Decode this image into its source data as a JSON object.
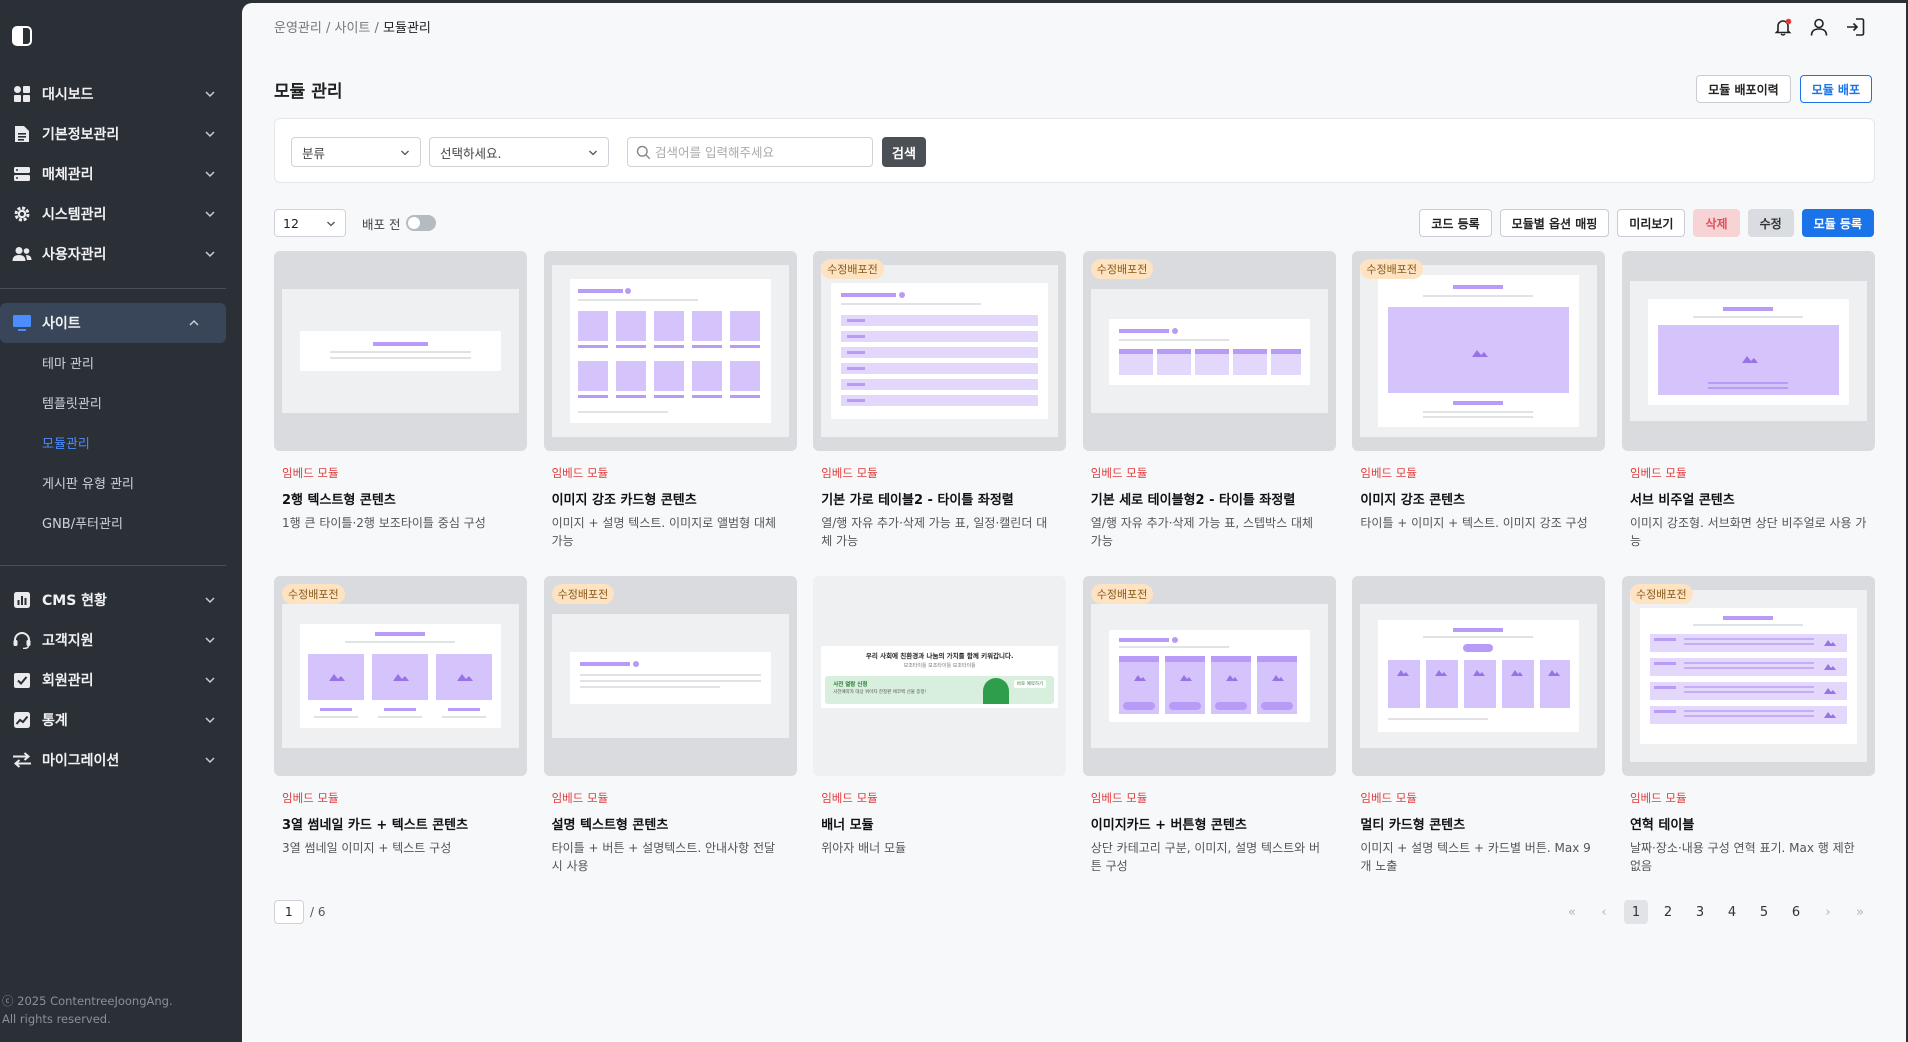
{
  "sidebar": {
    "menu": [
      {
        "label": "대시보드",
        "icon": "dashboard-icon"
      },
      {
        "label": "기본정보관리",
        "icon": "document-icon"
      },
      {
        "label": "매체관리",
        "icon": "server-icon"
      },
      {
        "label": "시스템관리",
        "icon": "gear-icon"
      },
      {
        "label": "사용자관리",
        "icon": "users-icon"
      }
    ],
    "site": {
      "label": "사이트",
      "icon": "monitor-icon",
      "sub": [
        "테마 관리",
        "템플릿관리",
        "모듈관리",
        "게시판 유형 관리",
        "GNB/푸터관리"
      ]
    },
    "menu2": [
      {
        "label": "CMS 현황",
        "icon": "chart-icon"
      },
      {
        "label": "고객지원",
        "icon": "headset-icon"
      },
      {
        "label": "회원관리",
        "icon": "checklist-icon"
      },
      {
        "label": "통계",
        "icon": "trend-icon"
      },
      {
        "label": "마이그레이션",
        "icon": "migrate-icon"
      }
    ],
    "copyright_1": "ⓒ 2025 ContentreeJoongAng.",
    "copyright_2": "All rights reserved."
  },
  "breadcrumb": {
    "a": "운영관리",
    "b": "사이트",
    "c": "모듈관리",
    "sep": " / "
  },
  "page": {
    "title": "모듈 관리",
    "btn_history": "모듈 배포이력",
    "btn_deploy": "모듈 배포"
  },
  "search": {
    "category": "분류",
    "select": "선택하세요.",
    "placeholder": "검색어를 입력해주세요",
    "button": "검색"
  },
  "toolbar": {
    "page_size": "12",
    "toggle_label": "배포 전",
    "code_register": "코드 등록",
    "option_mapping": "모듈별 옵션 매핑",
    "preview": "미리보기",
    "delete": "삭제",
    "edit": "수정",
    "module_register": "모듈 등록"
  },
  "cards": [
    {
      "badge": "",
      "cat": "임베드 모듈",
      "title": "2행 텍스트형 콘텐츠",
      "desc": "1행 큰 타이틀·2행 보조타이틀 중심 구성"
    },
    {
      "badge": "",
      "cat": "임베드 모듈",
      "title": "이미지 강조 카드형 콘텐츠",
      "desc": "이미지 + 설명 텍스트. 이미지로 앨범형 대체 가능"
    },
    {
      "badge": "수정배포전",
      "cat": "임베드 모듈",
      "title": "기본 가로 테이블2 - 타이틀 좌정렬",
      "desc": "열/행 자유 추가·삭제 가능 표, 일정·캘린더 대체 가능"
    },
    {
      "badge": "수정배포전",
      "cat": "임베드 모듈",
      "title": "기본 세로 테이블형2 - 타이틀 좌정렬",
      "desc": "열/행 자유 추가·삭제 가능 표, 스텝박스 대체 가능"
    },
    {
      "badge": "수정배포전",
      "cat": "임베드 모듈",
      "title": "이미지 강조 콘텐츠",
      "desc": "타이틀 + 이미지 + 텍스트. 이미지 강조 구성"
    },
    {
      "badge": "",
      "cat": "임베드 모듈",
      "title": "서브 비주얼 콘텐츠",
      "desc": "이미지 강조형. 서브화면 상단 비주얼로 사용 가능"
    },
    {
      "badge": "수정배포전",
      "cat": "임베드 모듈",
      "title": "3열 썸네일 카드 + 텍스트 콘텐츠",
      "desc": "3열 썸네일 이미지 + 텍스트 구성"
    },
    {
      "badge": "수정배포전",
      "cat": "임베드 모듈",
      "title": "설명 텍스트형 콘텐츠",
      "desc": "타이틀 + 버튼 + 설명텍스트. 안내사항 전달 시 사용"
    },
    {
      "badge": "",
      "cat": "임베드 모듈",
      "title": "배너 모듈",
      "desc": "위아자 배너 모듈"
    },
    {
      "badge": "수정배포전",
      "cat": "임베드 모듈",
      "title": "이미지카드 + 버튼형 콘텐츠",
      "desc": "상단 카테고리 구분, 이미지, 설명 텍스트와 버튼 구성"
    },
    {
      "badge": "",
      "cat": "임베드 모듈",
      "title": "멀티 카드형 콘텐츠",
      "desc": "이미지 + 설명 텍스트 + 카드별 버튼. Max 9개 노출"
    },
    {
      "badge": "수정배포전",
      "cat": "임베드 모듈",
      "title": "연혁 테이블",
      "desc": "날짜·장소·내용 구성 연혁 표기. Max 행 제한 없음"
    }
  ],
  "banner": {
    "headline": "우리 사회에 친환경과 나눔의 가치를 함께 키워갑니다.",
    "sub": "보조타이틀 보조타이틀 보조타이틀",
    "strip_title": "사전 열람 신청",
    "strip_text": "사전예약자 대상 위아자 한정판 에코백 선물 증정!",
    "strip_btn": "바로 예약하기"
  },
  "pager": {
    "current": "1",
    "total": "/ 6",
    "pages": [
      "1",
      "2",
      "3",
      "4",
      "5",
      "6"
    ]
  },
  "colors": {
    "accent": "#1a73e8",
    "thumb_purple": "#d5c4fb",
    "badge_bg": "#fde3c2",
    "category": "#e03c3c"
  }
}
